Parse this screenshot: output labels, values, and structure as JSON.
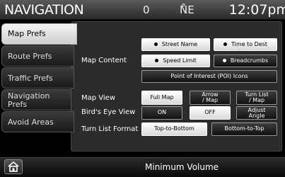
{
  "header": {
    "title": "NAVIGATION",
    "status_a": "0",
    "status_b": "N̊E",
    "clock": "12:07pm"
  },
  "tabs": [
    {
      "label": "Map Prefs"
    },
    {
      "label": "Route Prefs"
    },
    {
      "label": "Traffic Prefs"
    },
    {
      "label": "Navigation Prefs"
    },
    {
      "label": "Avoid Areas"
    }
  ],
  "map_content": {
    "label": "Map Content",
    "street_name": "Street Name",
    "time_to_dest": "Time to Dest",
    "speed_limit": "Speed Limit",
    "breadcrumbs": "Breadcrumbs",
    "poi_icons": "Point of Interest (POI) Icons"
  },
  "map_view": {
    "label": "Map View",
    "full_map": "Full Map",
    "arrow_map_1": "Arrow",
    "arrow_map_2": "/ Map",
    "turn_list_1": "Turn List",
    "turn_list_2": "/ Map"
  },
  "birds_eye": {
    "label": "Bird's Eye View",
    "on": "ON",
    "off": "OFF",
    "adjust_1": "Adjust",
    "adjust_2": "Angle"
  },
  "turn_list_format": {
    "label": "Turn List Format",
    "top_to_bottom": "Top-to-Bottom",
    "bottom_to_top": "Bottom-to-Top"
  },
  "footer": {
    "text": "Minimum Volume"
  }
}
